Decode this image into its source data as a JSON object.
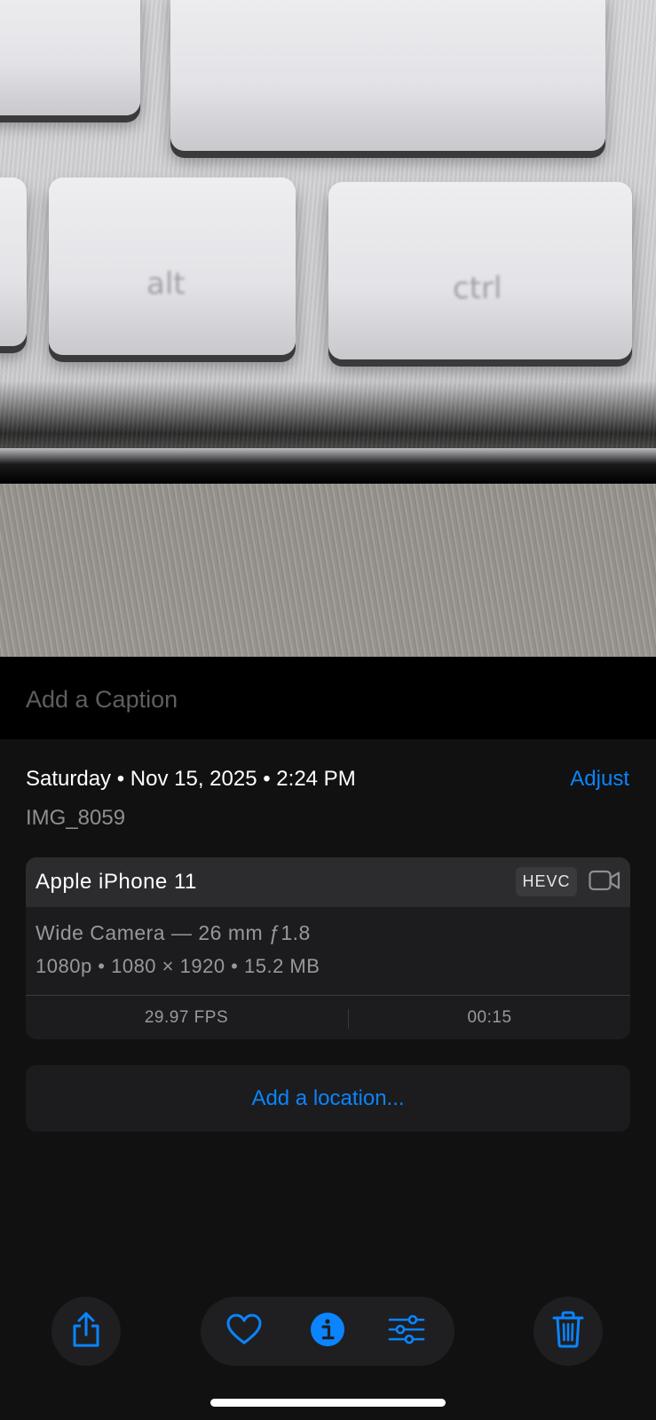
{
  "caption": {
    "placeholder": "Add a Caption"
  },
  "info": {
    "date": "Saturday • Nov 15, 2025 • 2:24 PM",
    "adjust_label": "Adjust",
    "filename": "IMG_8059"
  },
  "camera_card": {
    "device": "Apple iPhone 11",
    "format_badge": "HEVC",
    "lens": "Wide Camera — 26 mm ƒ1.8",
    "specs": "1080p • 1080 × 1920 • 15.2 MB",
    "fps": "29.97 FPS",
    "duration": "00:15"
  },
  "location": {
    "label": "Add a location..."
  },
  "photo": {
    "key_glyphs": [
      "alt",
      "ctrl"
    ]
  },
  "icons": {
    "share": "share-icon",
    "favorite": "heart-icon",
    "info": "info-icon",
    "edit": "sliders-icon",
    "delete": "trash-icon",
    "video": "video-camera-icon"
  },
  "colors": {
    "accent": "#0a84ff",
    "background": "#111111",
    "card": "#1c1c1e",
    "secondary_text": "#8e8e93"
  }
}
